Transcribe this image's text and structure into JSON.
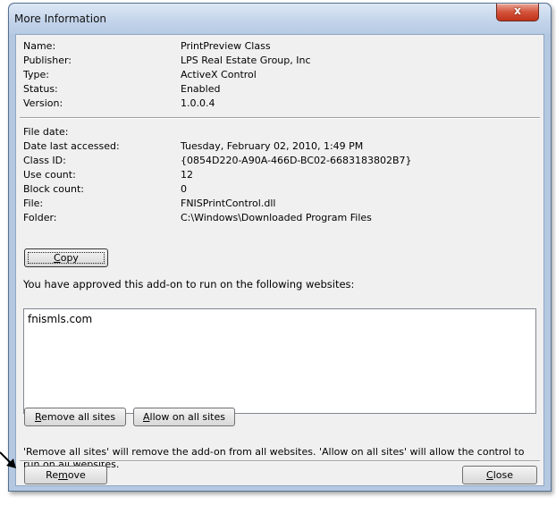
{
  "window": {
    "title": "More Information",
    "close_glyph": "x"
  },
  "info": [
    {
      "label": "Name:",
      "value": "PrintPreview Class"
    },
    {
      "label": "Publisher:",
      "value": "LPS Real Estate Group, Inc"
    },
    {
      "label": "Type:",
      "value": "ActiveX Control"
    },
    {
      "label": "Status:",
      "value": "Enabled"
    },
    {
      "label": "Version:",
      "value": "1.0.0.4"
    }
  ],
  "details": [
    {
      "label": "File date:",
      "value": ""
    },
    {
      "label": "Date last accessed:",
      "value": "Tuesday, February 02, 2010, 1:49 PM"
    },
    {
      "label": "Class ID:",
      "value": "{0854D220-A90A-466D-BC02-6683183802B7}"
    },
    {
      "label": "Use count:",
      "value": "12"
    },
    {
      "label": "Block count:",
      "value": "0"
    },
    {
      "label": "File:",
      "value": "FNISPrintControl.dll"
    },
    {
      "label": "Folder:",
      "value": "C:\\Windows\\Downloaded Program Files"
    }
  ],
  "buttons": {
    "copy": {
      "pre": "",
      "key": "C",
      "post": "opy"
    },
    "remove_all": {
      "pre": "",
      "key": "R",
      "post": "emove all sites"
    },
    "allow_all": {
      "pre": "",
      "key": "A",
      "post": "llow on all sites"
    },
    "remove": {
      "pre": "Re",
      "key": "m",
      "post": "ove"
    },
    "close": {
      "pre": "",
      "key": "C",
      "post": "lose"
    }
  },
  "sites_heading": "You have approved this add-on to run on the following websites:",
  "sites": [
    "fnismls.com"
  ],
  "note": "'Remove all sites' will remove the add-on from all websites. 'Allow on all sites' will allow the control to run on all websites."
}
